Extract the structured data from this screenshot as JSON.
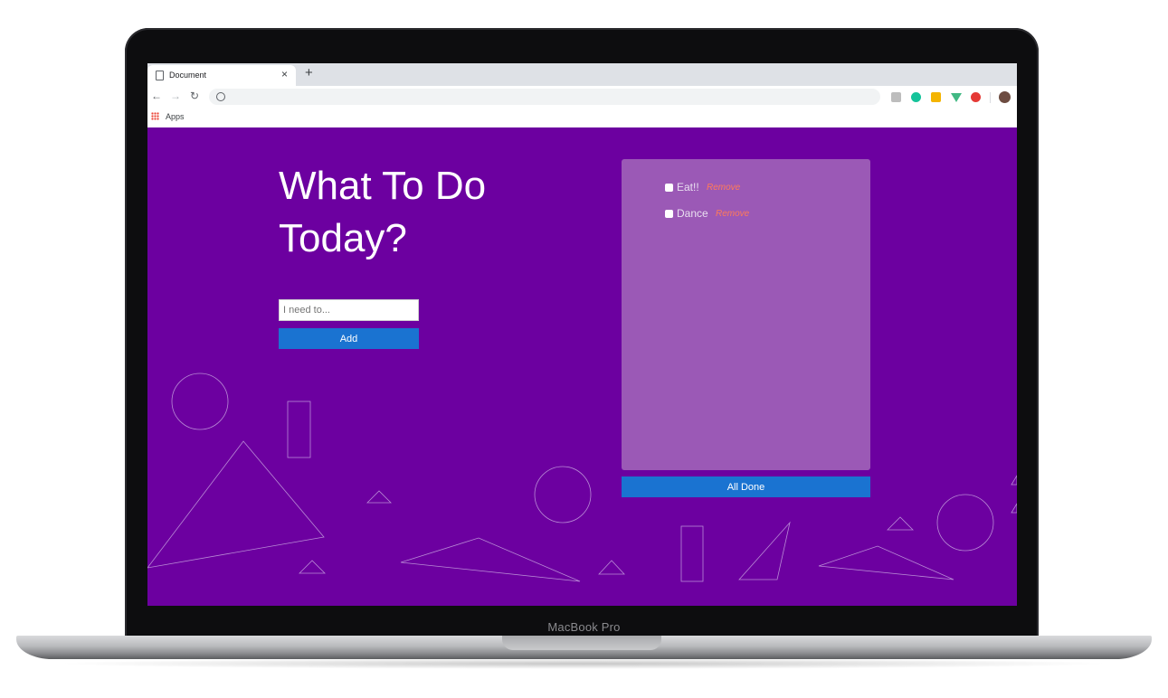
{
  "device": {
    "label": "MacBook Pro"
  },
  "browser": {
    "tab_title": "Document",
    "tab_close": "×",
    "new_tab": "+",
    "back": "←",
    "forward": "→",
    "reload": "↻",
    "bookmarks": [
      {
        "label": "Apps"
      }
    ]
  },
  "app": {
    "heading_line1": "What To Do",
    "heading_line2": "Today?",
    "input_placeholder": "I need to...",
    "add_label": "Add",
    "todos": [
      {
        "text": "Eat!!",
        "remove_label": "Remove",
        "checked": false
      },
      {
        "text": "Dance",
        "remove_label": "Remove",
        "checked": false
      }
    ],
    "all_done_label": "All Done",
    "colors": {
      "background": "#6c00a0",
      "panel": "#9b59b6",
      "button": "#1a73d1",
      "remove_link": "#ff7a59"
    }
  }
}
